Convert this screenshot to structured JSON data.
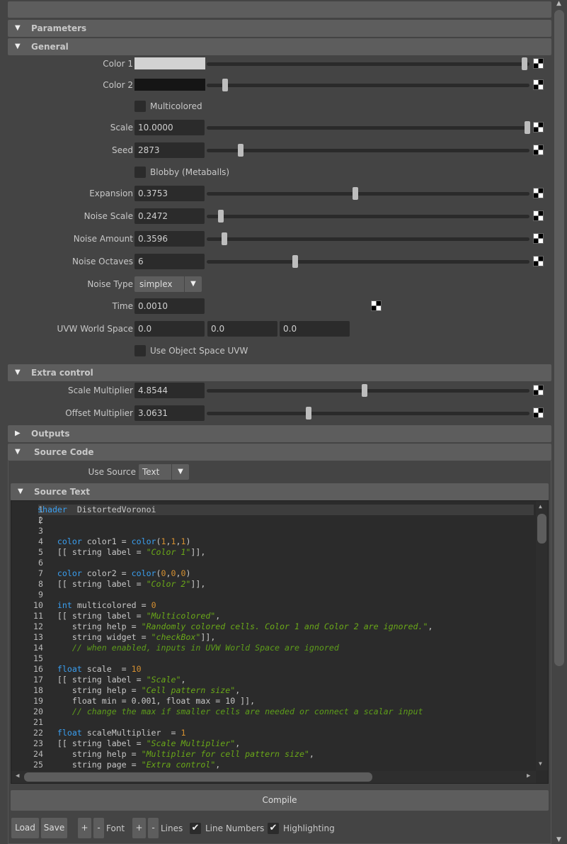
{
  "sections": {
    "parameters": "Parameters",
    "general": "General",
    "extra": "Extra control",
    "outputs": "Outputs",
    "source_code": "Source Code",
    "source_text": "Source Text"
  },
  "general": {
    "color1": {
      "label": "Color 1",
      "swatch": "#d2d2d2",
      "slider": 0.99
    },
    "color2": {
      "label": "Color 2",
      "swatch": "#151515",
      "slider": 0.04
    },
    "multicolored": {
      "label": "Multicolored",
      "checked": false
    },
    "scale": {
      "label": "Scale",
      "value": "10.0000",
      "slider": 1.0
    },
    "seed": {
      "label": "Seed",
      "value": "2873",
      "slider": 0.09
    },
    "blobby": {
      "label": "Blobby (Metaballs)",
      "checked": false
    },
    "expansion": {
      "label": "Expansion",
      "value": "0.3753",
      "slider": 0.455
    },
    "noise_scale": {
      "label": "Noise Scale",
      "value": "0.2472",
      "slider": 0.027
    },
    "noise_amount": {
      "label": "Noise Amount",
      "value": "0.3596",
      "slider": 0.038
    },
    "noise_octaves": {
      "label": "Noise Octaves",
      "value": "6",
      "slider": 0.263
    },
    "noise_type": {
      "label": "Noise Type",
      "value": "simplex"
    },
    "time": {
      "label": "Time",
      "value": "0.0010"
    },
    "uvw": {
      "label": "UVW World Space",
      "x": "0.0",
      "y": "0.0",
      "z": "0.0"
    },
    "object_uvw": {
      "label": "Use Object Space UVW",
      "checked": false
    }
  },
  "extra": {
    "scale_mult": {
      "label": "Scale Multiplier",
      "value": "4.8544",
      "slider": 0.483
    },
    "offset_mult": {
      "label": "Offset Multiplier",
      "value": "3.0631",
      "slider": 0.305
    }
  },
  "source": {
    "use_label": "Use Source",
    "use_value": "Text"
  },
  "code_lines": [
    [
      [
        "kw",
        "shader"
      ],
      [
        "",
        "  DistortedVoronoi"
      ]
    ],
    [
      [
        "",
        "("
      ]
    ],
    [],
    [
      [
        "",
        "    "
      ],
      [
        "kw",
        "color"
      ],
      [
        "",
        " color1 = "
      ],
      [
        "kw",
        "color"
      ],
      [
        "",
        "("
      ],
      [
        "nm",
        "1"
      ],
      [
        "",
        ","
      ],
      [
        "nm",
        "1"
      ],
      [
        "",
        ","
      ],
      [
        "nm",
        "1"
      ],
      [
        "",
        ")"
      ]
    ],
    [
      [
        "",
        "    [[ string label = "
      ],
      [
        "st",
        "\"Color 1\""
      ],
      [
        "",
        "]],"
      ]
    ],
    [],
    [
      [
        "",
        "    "
      ],
      [
        "kw",
        "color"
      ],
      [
        "",
        " color2 = "
      ],
      [
        "kw",
        "color"
      ],
      [
        "",
        "("
      ],
      [
        "nm",
        "0"
      ],
      [
        "",
        ","
      ],
      [
        "nm",
        "0"
      ],
      [
        "",
        ","
      ],
      [
        "nm",
        "0"
      ],
      [
        "",
        ")"
      ]
    ],
    [
      [
        "",
        "    [[ string label = "
      ],
      [
        "st",
        "\"Color 2\""
      ],
      [
        "",
        "]],"
      ]
    ],
    [],
    [
      [
        "",
        "    "
      ],
      [
        "kw",
        "int"
      ],
      [
        "",
        " multicolored = "
      ],
      [
        "nm",
        "0"
      ]
    ],
    [
      [
        "",
        "    [[ string label = "
      ],
      [
        "st",
        "\"Multicolored\""
      ],
      [
        "",
        ","
      ]
    ],
    [
      [
        "",
        "       string help = "
      ],
      [
        "st",
        "\"Randomly colored cells. Color 1 and Color 2 are ignored.\""
      ],
      [
        "",
        ","
      ]
    ],
    [
      [
        "",
        "       string widget = "
      ],
      [
        "st",
        "\"checkBox\""
      ],
      [
        "",
        "]],"
      ]
    ],
    [
      [
        "",
        "       "
      ],
      [
        "cm",
        "// when enabled, inputs in UVW World Space are ignored"
      ]
    ],
    [],
    [
      [
        "",
        "    "
      ],
      [
        "kw",
        "float"
      ],
      [
        "",
        " scale  = "
      ],
      [
        "nm",
        "10"
      ]
    ],
    [
      [
        "",
        "    [[ string label = "
      ],
      [
        "st",
        "\"Scale\""
      ],
      [
        "",
        ","
      ]
    ],
    [
      [
        "",
        "       string help = "
      ],
      [
        "st",
        "\"Cell pattern size\""
      ],
      [
        "",
        ","
      ]
    ],
    [
      [
        "",
        "       float min = 0.001, float max = 10 ]],"
      ]
    ],
    [
      [
        "",
        "       "
      ],
      [
        "cm",
        "// change the max if smaller cells are needed or connect a scalar input"
      ]
    ],
    [],
    [
      [
        "",
        "    "
      ],
      [
        "kw",
        "float"
      ],
      [
        "",
        " scaleMultiplier  = "
      ],
      [
        "nm",
        "1"
      ]
    ],
    [
      [
        "",
        "    [[ string label = "
      ],
      [
        "st",
        "\"Scale Multiplier\""
      ],
      [
        "",
        ","
      ]
    ],
    [
      [
        "",
        "       string help = "
      ],
      [
        "st",
        "\"Multiplier for cell pattern size\""
      ],
      [
        "",
        ","
      ]
    ],
    [
      [
        "",
        "       string page = "
      ],
      [
        "st",
        "\"Extra control\""
      ],
      [
        "",
        ","
      ]
    ]
  ],
  "buttons": {
    "compile": "Compile",
    "load": "Load",
    "save": "Save",
    "plus": "+",
    "minus": "-",
    "font": "Font",
    "lines": "Lines",
    "line_numbers": "Line Numbers",
    "highlighting": "Highlighting"
  },
  "toggles": {
    "line_numbers": true,
    "highlighting": true
  }
}
